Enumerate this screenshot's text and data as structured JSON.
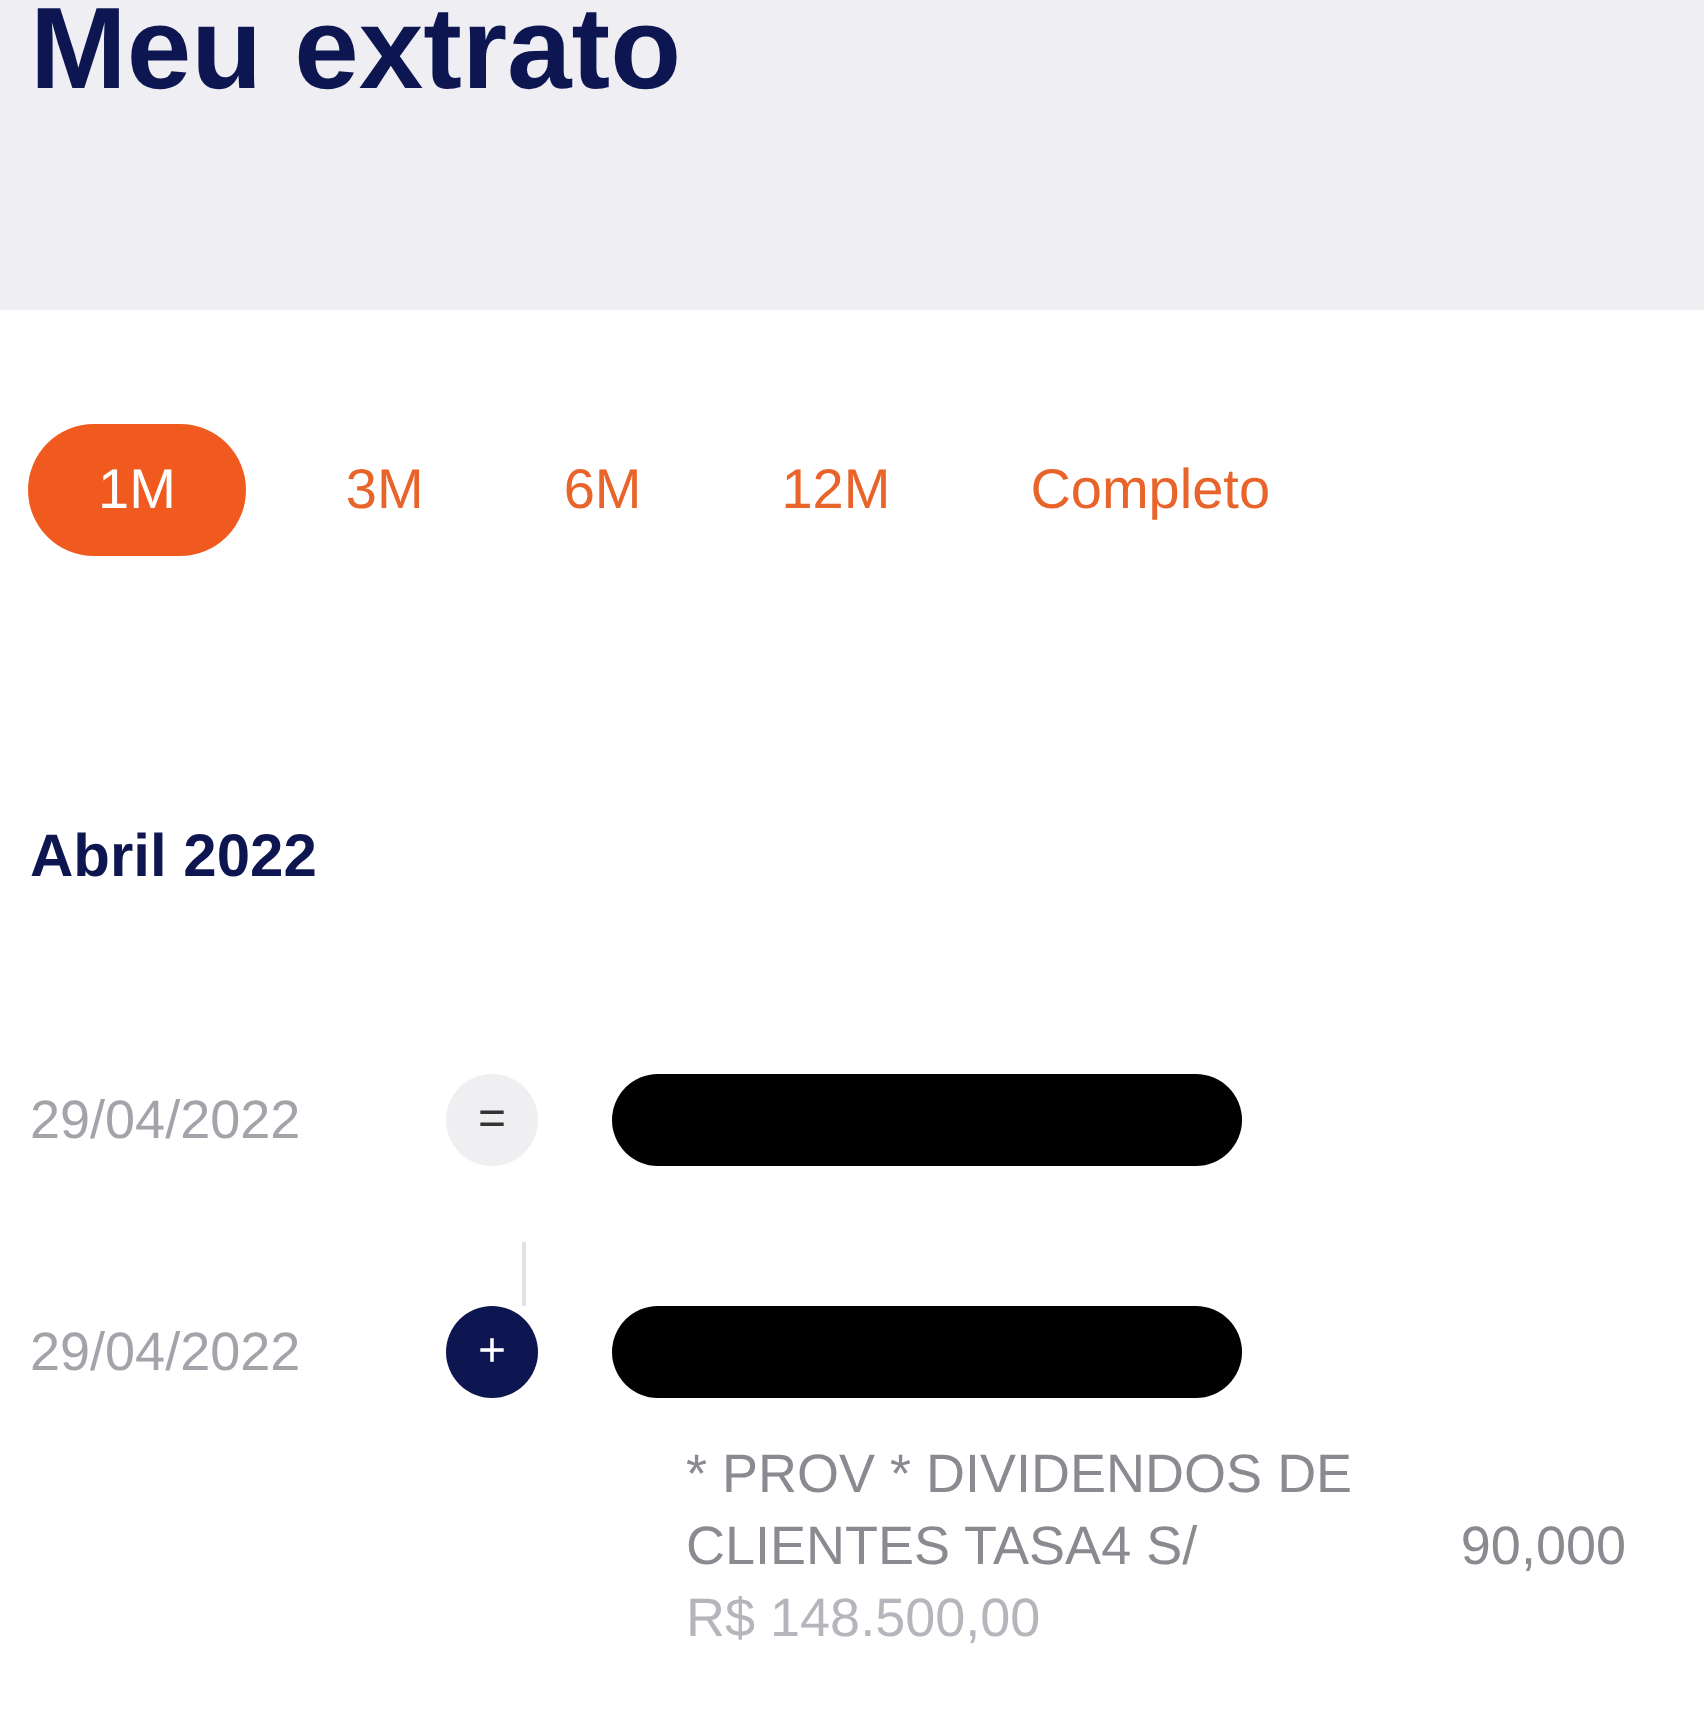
{
  "header": {
    "title": "Meu extrato"
  },
  "periods": [
    {
      "label": "1M",
      "selected": true
    },
    {
      "label": "3M",
      "selected": false
    },
    {
      "label": "6M",
      "selected": false
    },
    {
      "label": "12M",
      "selected": false
    },
    {
      "label": "Completo",
      "selected": false
    }
  ],
  "month": "Abril 2022",
  "entries": [
    {
      "date": "29/04/2022",
      "kind": "balance",
      "symbol": "=",
      "redacted": true
    },
    {
      "date": "29/04/2022",
      "kind": "credit",
      "symbol": "+",
      "redacted": true,
      "description_lines": [
        "* PROV * DIVIDENDOS DE",
        "CLIENTES TASA4 S/"
      ],
      "quantity": "90,000",
      "amount": "R$ 148.500,00"
    }
  ]
}
